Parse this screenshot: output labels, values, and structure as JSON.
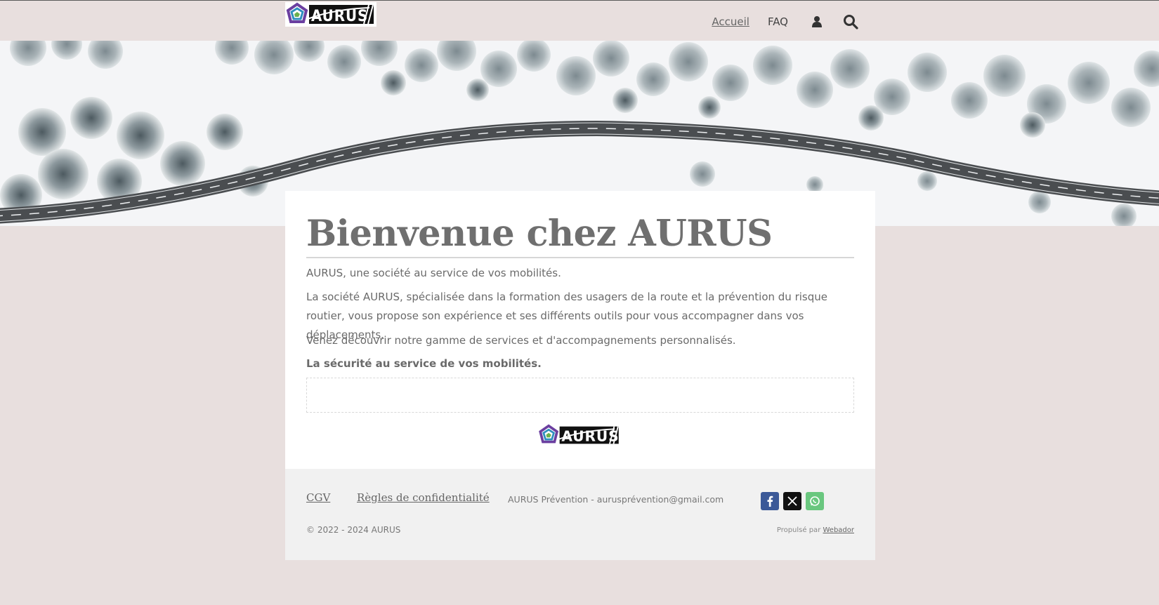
{
  "header": {
    "logo_text": "AURUS",
    "nav": {
      "home_label": "Accueil",
      "faq_label": "FAQ",
      "account_icon": "user-icon",
      "search_icon": "search-icon"
    }
  },
  "hero": {
    "image_semantic": "snowy-forest-road-aerial"
  },
  "main": {
    "title": "Bienvenue chez AURUS",
    "paragraph_1": "AURUS, une société au service de vos mobilités.",
    "paragraph_2": "La société AURUS, spécialisée dans la formation des usagers de la route et la prévention du risque routier, vous propose son expérience et ses différents outils pour vous accompagner dans vos déplacements.",
    "paragraph_3": "Venez découvrir notre gamme de services et d'accompagnements personnalisés.",
    "paragraph_4": "La sécurité au service de vos mobilités.",
    "logo_text": "AURUS"
  },
  "footer": {
    "cgv_label": "CGV",
    "privacy_label": "Règles de confidentialité",
    "contact_text": "AURUS Prévention - aurusprévention@gmail.com",
    "social": [
      "facebook-icon",
      "x-icon",
      "whatsapp-icon"
    ],
    "copyright": "© 2022 - 2024 AURUS",
    "powered_prefix": "Propulsé par ",
    "powered_link": "Webador"
  },
  "colors": {
    "background": "#e8dfde",
    "card": "#ffffff",
    "footer": "#f1f1f1",
    "facebook": "#3b5998",
    "x": "#111111",
    "whatsapp": "#6ac77f"
  }
}
